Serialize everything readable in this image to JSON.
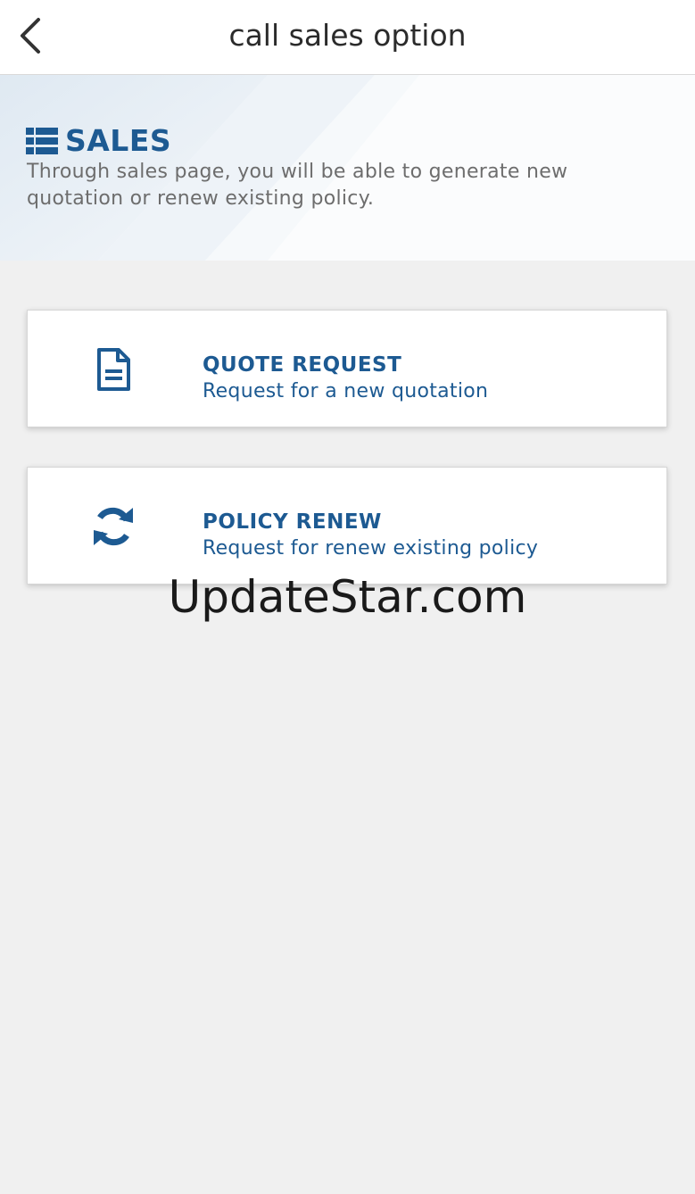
{
  "header": {
    "title": "call sales option",
    "back_icon": "chevron-left-icon"
  },
  "hero": {
    "icon": "list-icon",
    "title": "SALES",
    "description": "Through sales page, you will be able to generate new quotation or renew existing policy."
  },
  "options": [
    {
      "icon": "document-icon",
      "title": "QUOTE REQUEST",
      "subtitle": "Request for a new quotation"
    },
    {
      "icon": "refresh-icon",
      "title": "POLICY RENEW",
      "subtitle": "Request for renew existing policy"
    }
  ],
  "watermark": "UpdateStar.com",
  "colors": {
    "accent": "#1d5a92",
    "background": "#f0f0f0"
  }
}
